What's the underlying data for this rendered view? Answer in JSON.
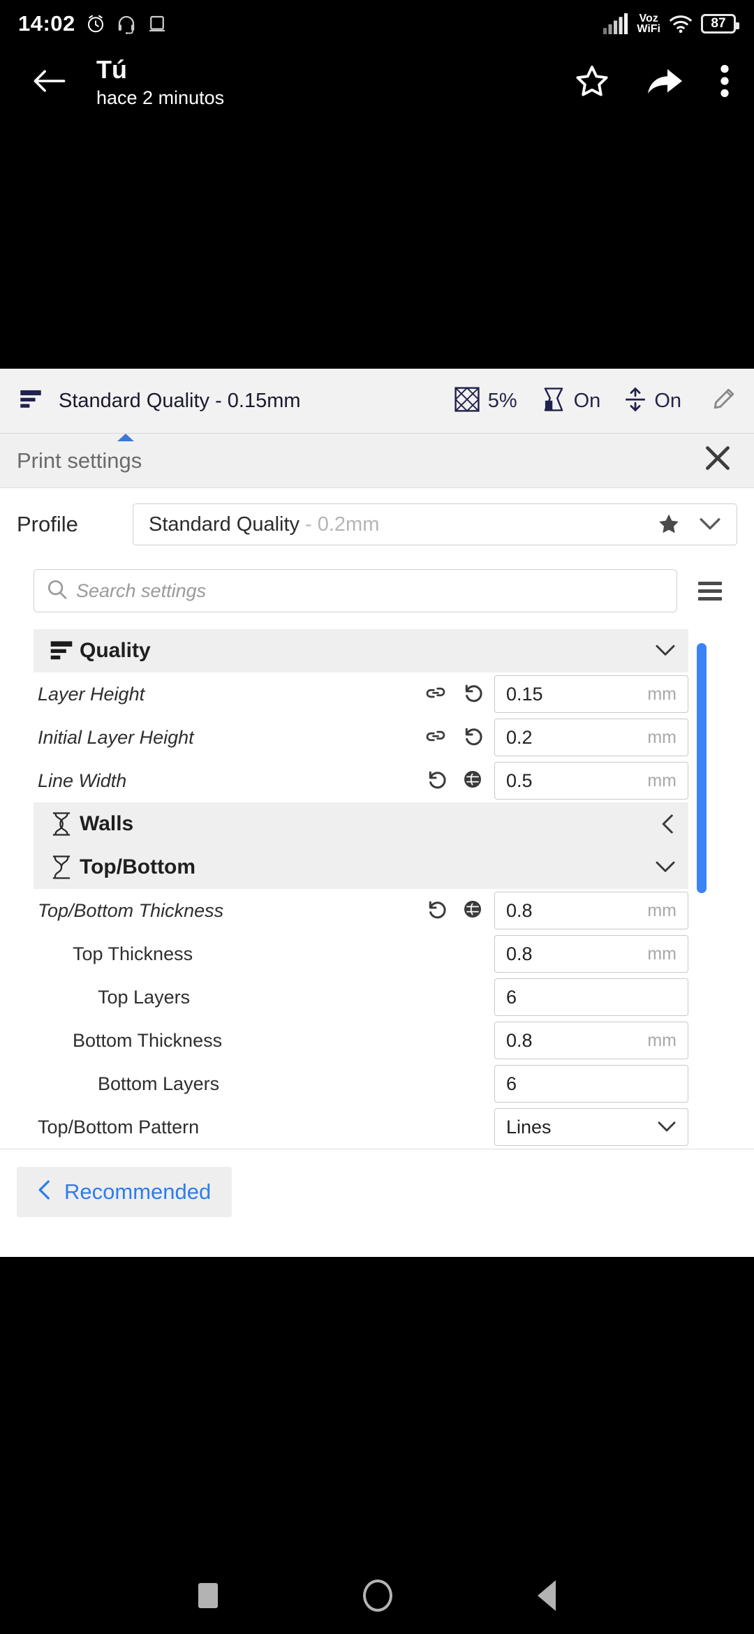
{
  "status_bar": {
    "time": "14:02",
    "icons_left": [
      "alarm-clock-icon",
      "headset-icon",
      "laptop-icon"
    ],
    "network_label": "Voz\nWiFi",
    "network_label_line1": "Voz",
    "network_label_line2": "WiFi",
    "icons_right": [
      "signal-bars-icon",
      "wifi-icon"
    ],
    "battery_level": "87"
  },
  "app_bar": {
    "back_icon": "back-arrow-icon",
    "title": "Tú",
    "subtitle": "hace 2 minutos",
    "actions": [
      "star-icon",
      "share-icon",
      "overflow-menu-icon"
    ]
  },
  "cura": {
    "mode_bar": {
      "profile_icon": "quality-layers-icon",
      "profile_label": "Standard Quality - 0.15mm",
      "stats": [
        {
          "icon": "infill-icon",
          "value": "5%"
        },
        {
          "icon": "support-icon",
          "value": "On"
        },
        {
          "icon": "adhesion-icon",
          "value": "On"
        }
      ],
      "edit_icon": "pencil-icon"
    },
    "panel": {
      "title": "Print settings",
      "close_icon": "close-icon"
    },
    "profile": {
      "label": "Profile",
      "value": "Standard Quality",
      "variant": "- 0.2mm",
      "star_icon": "star-filled-icon",
      "chevron_icon": "chevron-down-icon"
    },
    "search": {
      "icon": "search-icon",
      "placeholder": "Search settings",
      "menu_icon": "hamburger-menu-icon"
    },
    "scrollbar": {
      "color": "#3b82f6"
    },
    "sections": [
      {
        "name": "Quality",
        "icon": "quality-layers-icon",
        "expanded": true,
        "chevron": "chevron-down-icon",
        "rows": [
          {
            "label": "Layer Height",
            "italic": true,
            "indent": 0,
            "icons": [
              "link-icon",
              "revert-icon"
            ],
            "value": "0.15",
            "unit": "mm",
            "type": "text"
          },
          {
            "label": "Initial Layer Height",
            "italic": true,
            "indent": 0,
            "icons": [
              "link-icon",
              "revert-icon"
            ],
            "value": "0.2",
            "unit": "mm",
            "type": "text"
          },
          {
            "label": "Line Width",
            "italic": true,
            "indent": 0,
            "icons": [
              "revert-icon",
              "profile-value-icon"
            ],
            "value": "0.5",
            "unit": "mm",
            "type": "text"
          }
        ]
      },
      {
        "name": "Walls",
        "icon": "walls-icon",
        "expanded": false,
        "chevron": "chevron-left-icon",
        "rows": []
      },
      {
        "name": "Top/Bottom",
        "icon": "topbottom-icon",
        "expanded": true,
        "chevron": "chevron-down-icon",
        "rows": [
          {
            "label": "Top/Bottom Thickness",
            "italic": true,
            "indent": 0,
            "icons": [
              "revert-icon",
              "profile-value-icon"
            ],
            "value": "0.8",
            "unit": "mm",
            "type": "text"
          },
          {
            "label": "Top Thickness",
            "italic": false,
            "indent": 1,
            "icons": [],
            "value": "0.8",
            "unit": "mm",
            "type": "text"
          },
          {
            "label": "Top Layers",
            "italic": false,
            "indent": 2,
            "icons": [],
            "value": "6",
            "unit": "",
            "type": "text"
          },
          {
            "label": "Bottom Thickness",
            "italic": false,
            "indent": 1,
            "icons": [],
            "value": "0.8",
            "unit": "mm",
            "type": "text"
          },
          {
            "label": "Bottom Layers",
            "italic": false,
            "indent": 2,
            "icons": [],
            "value": "6",
            "unit": "",
            "type": "text"
          },
          {
            "label": "Top/Bottom Pattern",
            "italic": false,
            "indent": 0,
            "icons": [],
            "value": "Lines",
            "unit": "",
            "type": "select",
            "chevron": "chevron-down-icon"
          }
        ]
      }
    ],
    "footer": {
      "recommended_chevron": "chevron-left-icon",
      "recommended_label": "Recommended"
    }
  },
  "nav_bar": {
    "items": [
      "recents-square-icon",
      "home-circle-icon",
      "back-triangle-icon"
    ]
  }
}
